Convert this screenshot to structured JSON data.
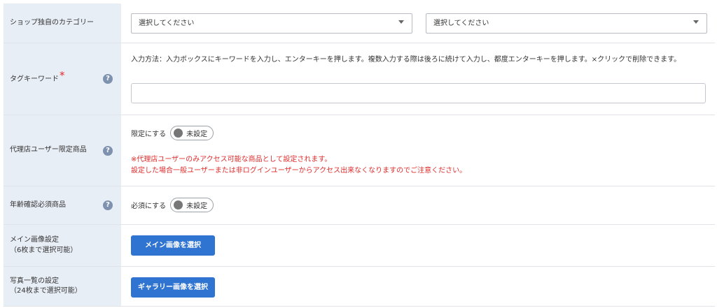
{
  "rows": {
    "category": {
      "label": "ショップ独自のカテゴリー",
      "select1": "選択してください",
      "select2": "選択してください"
    },
    "tag_keyword": {
      "label": "タグキーワード",
      "required_mark": "*",
      "help_glyph": "?",
      "instruction": "入力方法：入力ボックスにキーワードを入力し、エンターキーを押します。複数入力する際は後ろに続けて入力し、都度エンターキーを押します。×クリックで削除できます。",
      "input_value": ""
    },
    "agency_only": {
      "label": "代理店ユーザー限定商品",
      "help_glyph": "?",
      "toggle_label": "限定にする",
      "toggle_state": "未設定",
      "notice_line1": "※代理店ユーザーのみアクセス可能な商品として設定されます。",
      "notice_line2": "設定した場合一般ユーザーまたは非ログインユーザーからアクセス出来なくなりますのでご注意ください。"
    },
    "age_verification": {
      "label": "年齢確認必須商品",
      "help_glyph": "?",
      "toggle_label": "必須にする",
      "toggle_state": "未設定"
    },
    "main_image": {
      "label_line1": "メイン画像設定",
      "label_line2": "（6枚まで選択可能）",
      "button": "メイン画像を選択"
    },
    "photo_list": {
      "label_line1": "写真一覧の設定",
      "label_line2": "（24枚まで選択可能）",
      "button": "ギャラリー画像を選択"
    }
  },
  "colors": {
    "label_bg": "#e8eef6",
    "help_icon": "#7e92b0",
    "notice_red": "#e02b2b",
    "button_blue": "#2f74d1"
  }
}
